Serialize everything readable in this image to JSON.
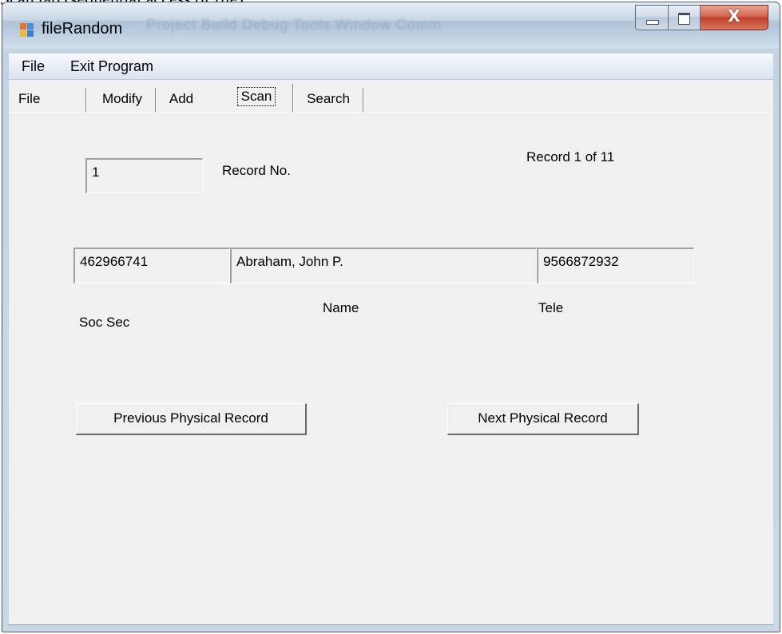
{
  "document": {
    "caption": "Scan tab (sequential access of file)"
  },
  "window": {
    "title": "fileRandom",
    "ghost_menu": "Project   Build   Debug   Tools   Window   Comm",
    "icon": "app-form-icon",
    "controls": {
      "minimize_icon": "minimize-icon",
      "maximize_icon": "maximize-icon",
      "close_icon": "close-icon",
      "close_glyph": "X"
    }
  },
  "menu": {
    "items": [
      {
        "label": "File"
      },
      {
        "label": "Exit Program"
      }
    ]
  },
  "tabs": [
    {
      "label": "File"
    },
    {
      "label": "Modify"
    },
    {
      "label": "Add"
    },
    {
      "label": "Scan"
    },
    {
      "label": "Search"
    }
  ],
  "selected_tab": "Scan",
  "scan": {
    "record_no_value": "1",
    "record_no_label": "Record No.",
    "record_count": "Record 1 of 11",
    "soc_sec_value": "462966741",
    "name_value": "Abraham, John P.",
    "tele_value": "9566872932",
    "soc_sec_label": "Soc Sec",
    "name_label": "Name",
    "tele_label": "Tele",
    "prev_button": "Previous Physical Record",
    "next_button": "Next Physical Record"
  },
  "colors": {
    "frame": "#b7cade",
    "client": "#f0f0f0",
    "close_button": "#c0412a"
  }
}
